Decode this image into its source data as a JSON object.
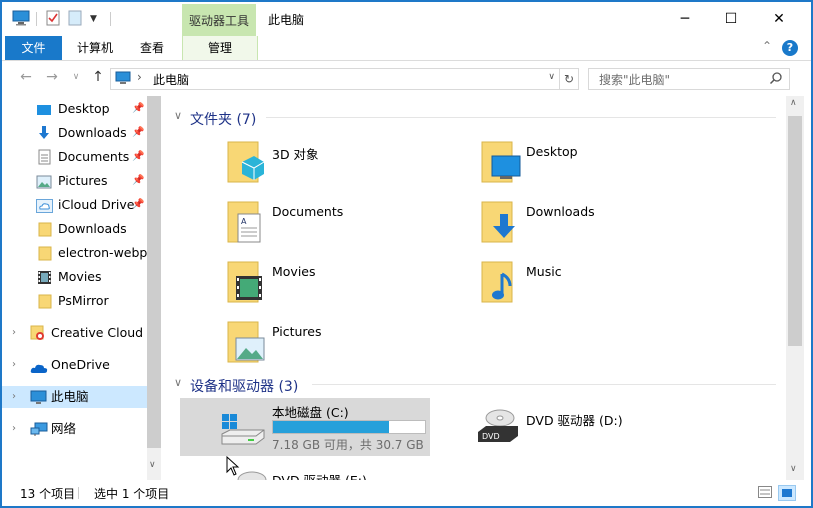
{
  "window": {
    "title": "此电脑",
    "minimize_glyph": "─",
    "maximize_glyph": "☐",
    "close_glyph": "✕"
  },
  "ribbon": {
    "context_group": "驱动器工具",
    "tabs": [
      {
        "label": "文件"
      },
      {
        "label": "计算机"
      },
      {
        "label": "查看"
      },
      {
        "label": "管理"
      }
    ],
    "collapse_glyph": "⌃",
    "help_glyph": "?"
  },
  "address": {
    "path_segment": "此电脑",
    "separator": "›",
    "search_placeholder": "搜索\"此电脑\""
  },
  "nav_pane": {
    "items": [
      {
        "label": "Desktop",
        "icon": "desktop-icon",
        "pinned": true
      },
      {
        "label": "Downloads",
        "icon": "download-icon",
        "pinned": true
      },
      {
        "label": "Documents",
        "icon": "document-icon",
        "pinned": true
      },
      {
        "label": "Pictures",
        "icon": "picture-icon",
        "pinned": true
      },
      {
        "label": "iCloud Drive",
        "icon": "cloud-icon",
        "pinned": true
      },
      {
        "label": "Downloads",
        "icon": "folder-icon",
        "pinned": false
      },
      {
        "label": "electron-webpa",
        "icon": "folder-icon",
        "pinned": false
      },
      {
        "label": "Movies",
        "icon": "movie-icon",
        "pinned": false
      },
      {
        "label": "PsMirror",
        "icon": "folder-icon",
        "pinned": false
      },
      {
        "label": "Creative Cloud F",
        "icon": "creative-cloud-icon",
        "pinned": false
      },
      {
        "label": "OneDrive",
        "icon": "onedrive-icon",
        "pinned": false
      },
      {
        "label": "此电脑",
        "icon": "this-pc-icon",
        "pinned": false,
        "selected": true
      },
      {
        "label": "网络",
        "icon": "network-icon",
        "pinned": false
      }
    ]
  },
  "content": {
    "folders_group": "文件夹 (7)",
    "folders": [
      {
        "label": "3D 对象",
        "icon": "3d-objects-folder-icon"
      },
      {
        "label": "Desktop",
        "icon": "desktop-folder-icon"
      },
      {
        "label": "Documents",
        "icon": "documents-folder-icon"
      },
      {
        "label": "Downloads",
        "icon": "downloads-folder-icon"
      },
      {
        "label": "Movies",
        "icon": "movies-folder-icon"
      },
      {
        "label": "Music",
        "icon": "music-folder-icon"
      },
      {
        "label": "Pictures",
        "icon": "pictures-folder-icon"
      }
    ],
    "devices_group": "设备和驱动器 (3)",
    "drives": [
      {
        "label": "本地磁盘 (C:)",
        "free_text": "7.18 GB 可用，共 30.7 GB",
        "used_fraction": 0.766,
        "selected": true
      },
      {
        "label": "DVD 驱动器 (D:)"
      },
      {
        "label": "DVD 驱动器 (E:)"
      }
    ]
  },
  "status": {
    "item_count": "13 个项目",
    "selection": "选中 1 个项目"
  },
  "colors": {
    "accent": "#1979ca",
    "selection": "#cce8ff",
    "drive_bar": "#26a0da",
    "context_tab": "#c8e6b0"
  }
}
